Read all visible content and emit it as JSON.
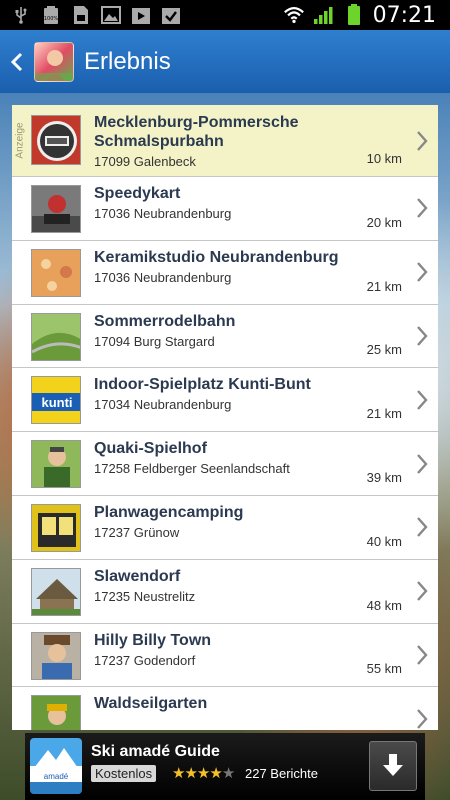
{
  "status_bar": {
    "time": "07:21",
    "battery_label": "100%",
    "icons_left": [
      "usb-icon",
      "battery-full-icon",
      "sd-card-icon",
      "image-icon",
      "play-store-icon",
      "task-done-icon"
    ],
    "icons_right": [
      "wifi-icon",
      "signal-icon",
      "battery-icon"
    ]
  },
  "header": {
    "title": "Erlebnis"
  },
  "ad_tag": "Anzeige",
  "items": [
    {
      "title": "Mecklenburg-Pommersche Schmalspurbahn",
      "address": "17099 Galenbeck",
      "distance": "10 km",
      "sponsored": true
    },
    {
      "title": "Speedykart",
      "address": "17036 Neubrandenburg",
      "distance": "20 km"
    },
    {
      "title": "Keramikstudio Neubrandenburg",
      "address": "17036 Neubrandenburg",
      "distance": "21 km"
    },
    {
      "title": "Sommerrodelbahn",
      "address": "17094 Burg Stargard",
      "distance": "25 km"
    },
    {
      "title": "Indoor-Spielplatz Kunti-Bunt",
      "address": "17034 Neubrandenburg",
      "distance": "21 km"
    },
    {
      "title": "Quaki-Spielhof",
      "address": "17258 Feldberger Seenlandschaft",
      "distance": "39 km"
    },
    {
      "title": "Planwagencamping",
      "address": "17237 Grünow",
      "distance": "40 km"
    },
    {
      "title": "Slawendorf",
      "address": "17235 Neustrelitz",
      "distance": "48 km"
    },
    {
      "title": "Hilly Billy Town",
      "address": "17237 Godendorf",
      "distance": "55 km"
    },
    {
      "title": "Waldseilgarten",
      "address": "",
      "distance": ""
    }
  ],
  "ad_banner": {
    "title": "Ski amadé Guide",
    "price": "Kostenlos",
    "rating": 4,
    "reviews": "227 Berichte",
    "logo_text": "amadé"
  },
  "colors": {
    "action_bar": "#1f66b4",
    "sponsored_row": "#f4f3c8",
    "title_text": "#2b3a50"
  }
}
